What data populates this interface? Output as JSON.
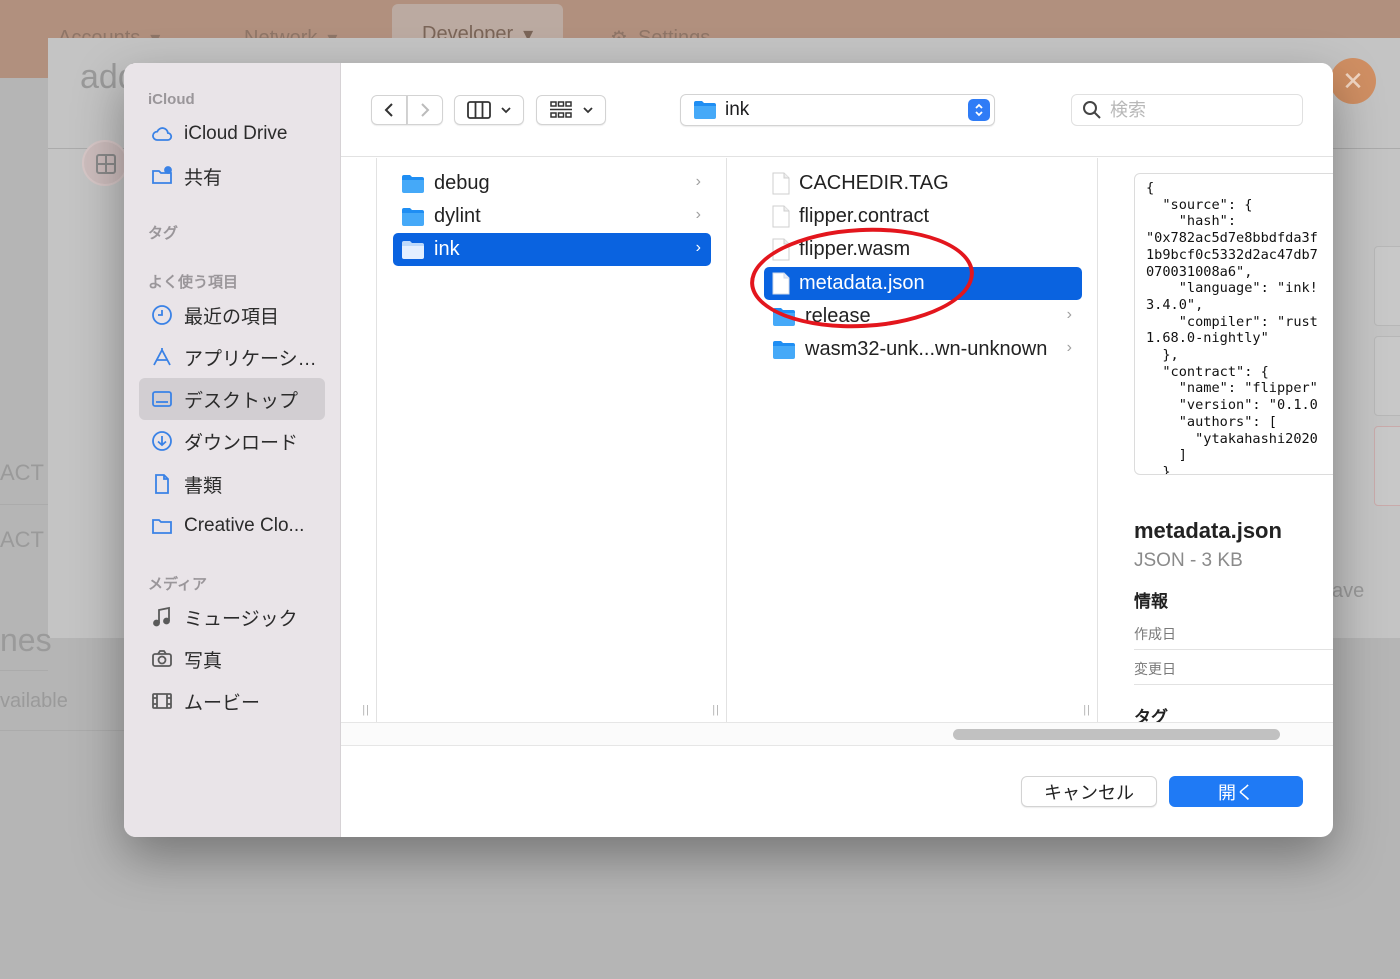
{
  "background": {
    "nav_tabs": [
      "Accounts",
      "Network",
      "Developer",
      "Settings"
    ],
    "partial_title": "add",
    "left_labels": [
      "ACT",
      "ACT",
      "nes",
      "vailable"
    ],
    "partial_button": "ave"
  },
  "sidebar": {
    "icloud_title": "iCloud",
    "icloud_items": [
      {
        "label": "iCloud Drive",
        "icon": "cloud-icon"
      },
      {
        "label": "共有",
        "icon": "shared-folder-icon"
      }
    ],
    "tags_title": "タグ",
    "favorites_title": "よく使う項目",
    "favorites_items": [
      {
        "label": "最近の項目",
        "icon": "clock-icon"
      },
      {
        "label": "アプリケーシ…",
        "icon": "applications-icon"
      },
      {
        "label": "デスクトップ",
        "icon": "desktop-icon",
        "selected": true
      },
      {
        "label": "ダウンロード",
        "icon": "download-icon"
      },
      {
        "label": "書類",
        "icon": "document-icon"
      },
      {
        "label": "Creative Clo...",
        "icon": "folder-icon"
      }
    ],
    "media_title": "メディア",
    "media_items": [
      {
        "label": "ミュージック",
        "icon": "music-note-icon"
      },
      {
        "label": "写真",
        "icon": "camera-icon"
      },
      {
        "label": "ムービー",
        "icon": "film-icon"
      }
    ]
  },
  "toolbar": {
    "path_name": "ink",
    "search_placeholder": "検索"
  },
  "column1": [
    {
      "name": "debug",
      "selected": false
    },
    {
      "name": "dylint",
      "selected": false
    },
    {
      "name": "ink",
      "selected": true
    }
  ],
  "column2": [
    {
      "name": "CACHEDIR.TAG",
      "type": "file"
    },
    {
      "name": "flipper.contract",
      "type": "file"
    },
    {
      "name": "flipper.wasm",
      "type": "file"
    },
    {
      "name": "metadata.json",
      "type": "file",
      "selected": true
    },
    {
      "name": "release",
      "type": "folder"
    },
    {
      "name": "wasm32-unk...wn-unknown",
      "type": "folder"
    }
  ],
  "preview": {
    "code": "{\n  \"source\": {\n    \"hash\":\n\"0x782ac5d7e8bbdfda3f\n1b9bcf0c5332d2ac47db7\n070031008a6\",\n    \"language\": \"ink!\n3.4.0\",\n    \"compiler\": \"rust\n1.68.0-nightly\"\n  },\n  \"contract\": {\n    \"name\": \"flipper\"\n    \"version\": \"0.1.0\n    \"authors\": [\n      \"ytakahashi2020\n    ]\n  },",
    "file_name": "metadata.json",
    "kind": "JSON - 3 KB",
    "info_title": "情報",
    "created_label": "作成日",
    "modified_label": "変更日",
    "tags_title": "タグ"
  },
  "buttons": {
    "cancel": "キャンセル",
    "open": "開く"
  },
  "colors": {
    "accent": "#0a63e0",
    "annotation": "#e3161d"
  }
}
